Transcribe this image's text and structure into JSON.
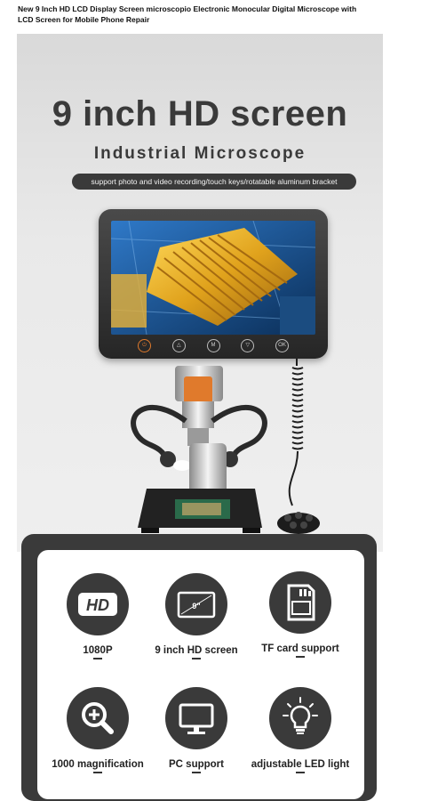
{
  "product_title": "New 9 Inch HD LCD Display Screen microscopio Electronic Monocular Digital Microscope with LCD Screen for Mobile Phone Repair",
  "banner": {
    "headline": "9 inch HD screen",
    "subhead": "Industrial Microscope",
    "features_pill": "support photo and video recording/touch keys/rotatable aluminum bracket",
    "screen_keys": [
      "OK",
      "M"
    ]
  },
  "features": [
    {
      "label": "1080P",
      "icon": "hd-icon",
      "icon_text": "HD"
    },
    {
      "label": "9 inch HD screen",
      "icon": "screen-size-icon",
      "icon_text": "9\""
    },
    {
      "label": "TF card support",
      "icon": "sd-card-icon"
    },
    {
      "label": "1000 magnification",
      "icon": "magnifier-icon"
    },
    {
      "label": "PC support",
      "icon": "monitor-icon"
    },
    {
      "label": "adjustable LED light",
      "icon": "bulb-icon"
    }
  ],
  "colors": {
    "accent_orange": "#e07a2c",
    "dark_panel": "#3a3a3a"
  }
}
